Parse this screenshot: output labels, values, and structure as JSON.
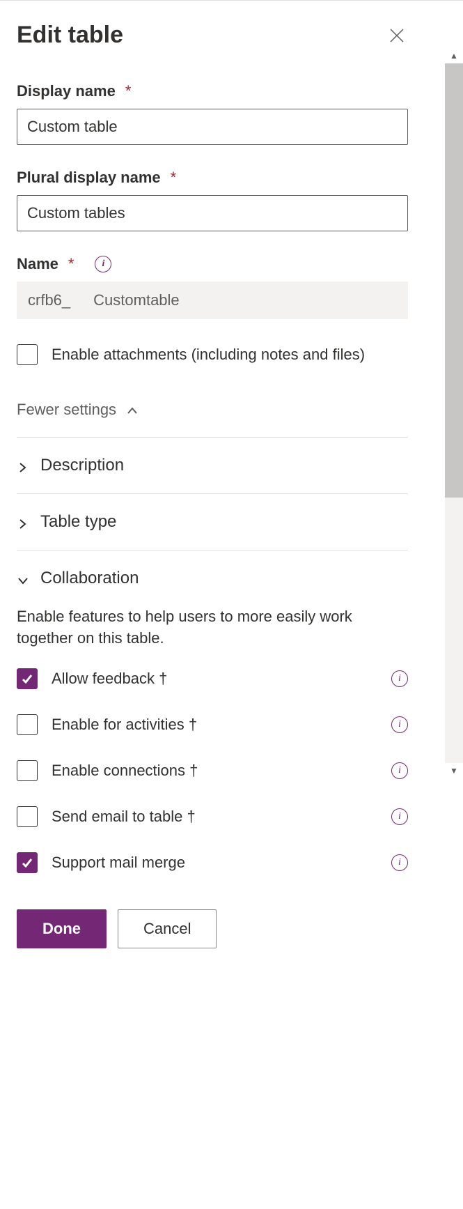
{
  "header": {
    "title": "Edit table"
  },
  "fields": {
    "display_name": {
      "label": "Display name",
      "value": "Custom table"
    },
    "plural_name": {
      "label": "Plural display name",
      "value": "Custom tables"
    },
    "name": {
      "label": "Name",
      "prefix": "crfb6_",
      "value": "Customtable"
    }
  },
  "attachments": {
    "label": "Enable attachments (including notes and files)",
    "checked": false
  },
  "toggle": {
    "label": "Fewer settings"
  },
  "sections": {
    "description": {
      "label": "Description",
      "expanded": false
    },
    "table_type": {
      "label": "Table type",
      "expanded": false
    },
    "collaboration": {
      "label": "Collaboration",
      "expanded": true,
      "description": "Enable features to help users to more easily work together on this table.",
      "items": [
        {
          "label": "Allow feedback †",
          "checked": true
        },
        {
          "label": "Enable for activities †",
          "checked": false
        },
        {
          "label": "Enable connections †",
          "checked": false
        },
        {
          "label": "Send email to table †",
          "checked": false
        },
        {
          "label": "Support mail merge",
          "checked": true
        }
      ]
    }
  },
  "footer": {
    "done": "Done",
    "cancel": "Cancel"
  }
}
